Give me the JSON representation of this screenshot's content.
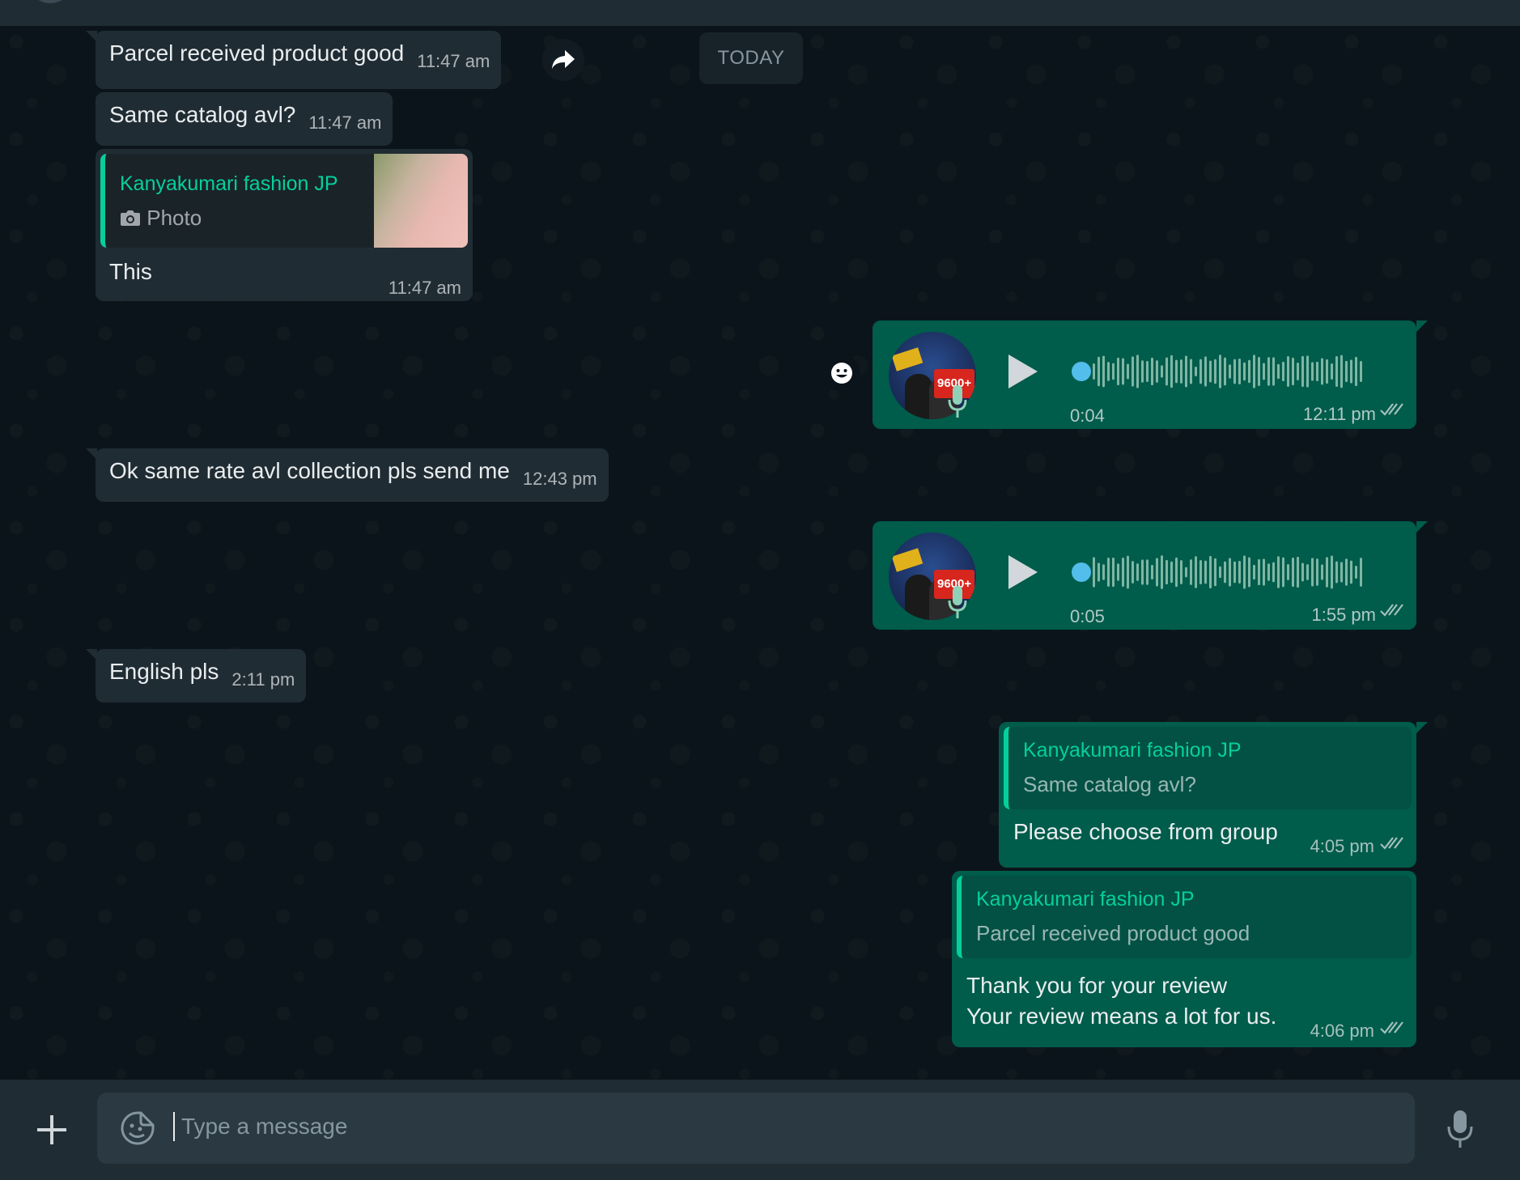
{
  "date_label": "TODAY",
  "messages": [
    {
      "text": "Parcel received  product  good",
      "time": "11:47 am"
    },
    {
      "text": "Same catalog  avl?",
      "time": "11:47 am"
    },
    {
      "quote_name": "Kanyakumari fashion JP",
      "quote_text": "Photo",
      "text": "This",
      "time": "11:47 am"
    },
    {
      "duration": "0:04",
      "time": "12:11 pm"
    },
    {
      "text": "Ok same rate avl collection  pls send me",
      "time": "12:43 pm"
    },
    {
      "duration": "0:05",
      "time": "1:55 pm"
    },
    {
      "text": "English  pls",
      "time": "2:11 pm"
    },
    {
      "quote_name": "Kanyakumari fashion JP",
      "quote_text": "Same catalog  avl?",
      "text": "Please choose from group",
      "time": "4:05 pm"
    },
    {
      "quote_name": "Kanyakumari fashion JP",
      "quote_text": "Parcel received  product  good",
      "line1": "Thank you for your review",
      "line2": "Your review means a lot for us.",
      "time": "4:06 pm"
    }
  ],
  "voice_avatar_badge": "9600+",
  "composer": {
    "placeholder": "Type a message"
  },
  "colors": {
    "incoming": "#202c33",
    "outgoing": "#005c4b",
    "accent": "#06cf9c",
    "background": "#0b141a"
  },
  "icons": [
    "forward-icon",
    "emoji-reaction-icon",
    "camera-icon",
    "play-icon",
    "mic-icon",
    "double-check-icon",
    "plus-icon",
    "sticker-icon"
  ]
}
